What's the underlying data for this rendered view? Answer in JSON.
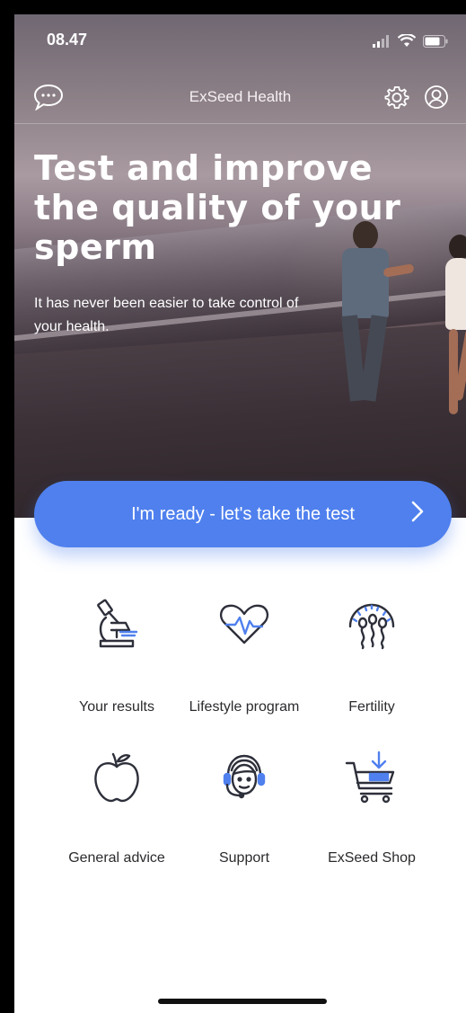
{
  "status_bar": {
    "time": "08.47"
  },
  "nav": {
    "title": "ExSeed Health",
    "chat_icon": "chat-bubble-icon",
    "settings_icon": "gear-icon",
    "profile_icon": "profile-icon"
  },
  "hero": {
    "headline": "Test and improve the quality of your sperm",
    "subline": "It has never been easier to take control of your health."
  },
  "cta": {
    "label": "I'm ready - let's take the test"
  },
  "tiles": [
    {
      "label": "Your results",
      "icon": "microscope-icon"
    },
    {
      "label": "Lifestyle program",
      "icon": "heartbeat-icon"
    },
    {
      "label": "Fertility",
      "icon": "sperm-icon"
    },
    {
      "label": "General advice",
      "icon": "apple-icon"
    },
    {
      "label": "Support",
      "icon": "headset-icon"
    },
    {
      "label": "ExSeed Shop",
      "icon": "cart-icon"
    }
  ],
  "colors": {
    "accent": "#4f80ee",
    "icon_dark": "#2d2f3a",
    "icon_blue": "#4f80ee"
  }
}
